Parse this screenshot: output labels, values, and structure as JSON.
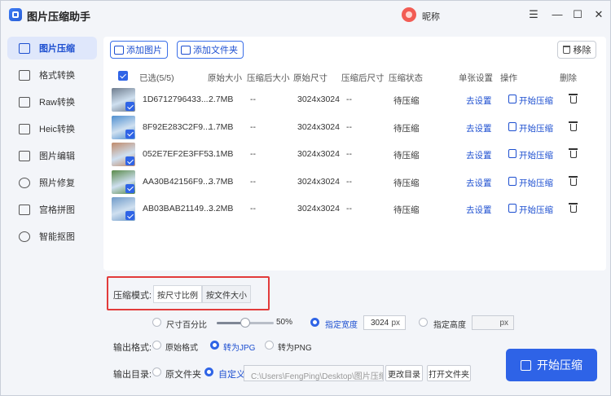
{
  "app": {
    "title": "图片压缩助手",
    "nickname": "昵称"
  },
  "window_controls": {
    "settings_icon": "☰",
    "minimize": "—",
    "maximize": "☐",
    "close": "✕"
  },
  "sidebar": {
    "items": [
      {
        "label": "图片压缩",
        "icon": "compress-icon",
        "active": true
      },
      {
        "label": "格式转换",
        "icon": "convert-icon"
      },
      {
        "label": "Raw转换",
        "icon": "raw-icon"
      },
      {
        "label": "Heic转换",
        "icon": "heic-icon"
      },
      {
        "label": "图片编辑",
        "icon": "edit-icon"
      },
      {
        "label": "照片修复",
        "icon": "repair-icon"
      },
      {
        "label": "宫格拼图",
        "icon": "grid-icon"
      },
      {
        "label": "智能抠图",
        "icon": "cutout-icon"
      }
    ]
  },
  "toolbar": {
    "add_image": "添加图片",
    "add_folder": "添加文件夹",
    "remove": "移除"
  },
  "table": {
    "headers": {
      "selected": "已选(5/5)",
      "orig_size": "原始大小",
      "comp_size": "压缩后大小",
      "orig_dim": "原始尺寸",
      "comp_dim": "压缩后尺寸",
      "status": "压缩状态",
      "single": "单张设置",
      "action": "操作",
      "delete": "删除"
    },
    "rows": [
      {
        "name": "1D6712796433...",
        "orig_size": "2.7MB",
        "comp_size": "--",
        "orig_dim": "3024x3024",
        "comp_dim": "--",
        "status": "待压缩",
        "settings": "去设置",
        "start": "开始压缩",
        "thumb": "#6f7d8e"
      },
      {
        "name": "8F92E283C2F9...",
        "orig_size": "1.7MB",
        "comp_size": "--",
        "orig_dim": "3024x3024",
        "comp_dim": "--",
        "status": "待压缩",
        "settings": "去设置",
        "start": "开始压缩",
        "thumb": "#4f8fcf"
      },
      {
        "name": "052E7EF2E3FF5...",
        "orig_size": "3.1MB",
        "comp_size": "--",
        "orig_dim": "3024x3024",
        "comp_dim": "--",
        "status": "待压缩",
        "settings": "去设置",
        "start": "开始压缩",
        "thumb": "#c08a6a"
      },
      {
        "name": "AA30B42156F9...",
        "orig_size": "3.7MB",
        "comp_size": "--",
        "orig_dim": "3024x3024",
        "comp_dim": "--",
        "status": "待压缩",
        "settings": "去设置",
        "start": "开始压缩",
        "thumb": "#5a8a4a"
      },
      {
        "name": "AB03BAB21149...",
        "orig_size": "3.2MB",
        "comp_size": "--",
        "orig_dim": "3024x3024",
        "comp_dim": "--",
        "status": "待压缩",
        "settings": "去设置",
        "start": "开始压缩",
        "thumb": "#6f9ac8"
      }
    ]
  },
  "compress": {
    "mode_label": "压缩模式:",
    "mode_by_ratio": "按尺寸比例",
    "mode_by_size": "按文件大小",
    "percent_label": "尺寸百分比",
    "percent_value": "50%",
    "percent_fraction": 0.5,
    "width_label": "指定宽度",
    "width_value": "3024",
    "width_unit": "px",
    "height_label": "指定高度",
    "height_unit": "px"
  },
  "output": {
    "format_label": "输出格式:",
    "format_original": "原始格式",
    "format_jpg": "转为JPG",
    "format_png": "转为PNG",
    "dir_label": "输出目录:",
    "dir_original": "原文件夹",
    "dir_custom": "自定义",
    "dir_path": "C:\\Users\\FengPing\\Desktop\\图片压缩",
    "change_dir": "更改目录",
    "open_dir": "打开文件夹"
  },
  "start_button": "开始压缩",
  "colors": {
    "accent": "#2e63e7",
    "highlight": "#e23b3b"
  }
}
